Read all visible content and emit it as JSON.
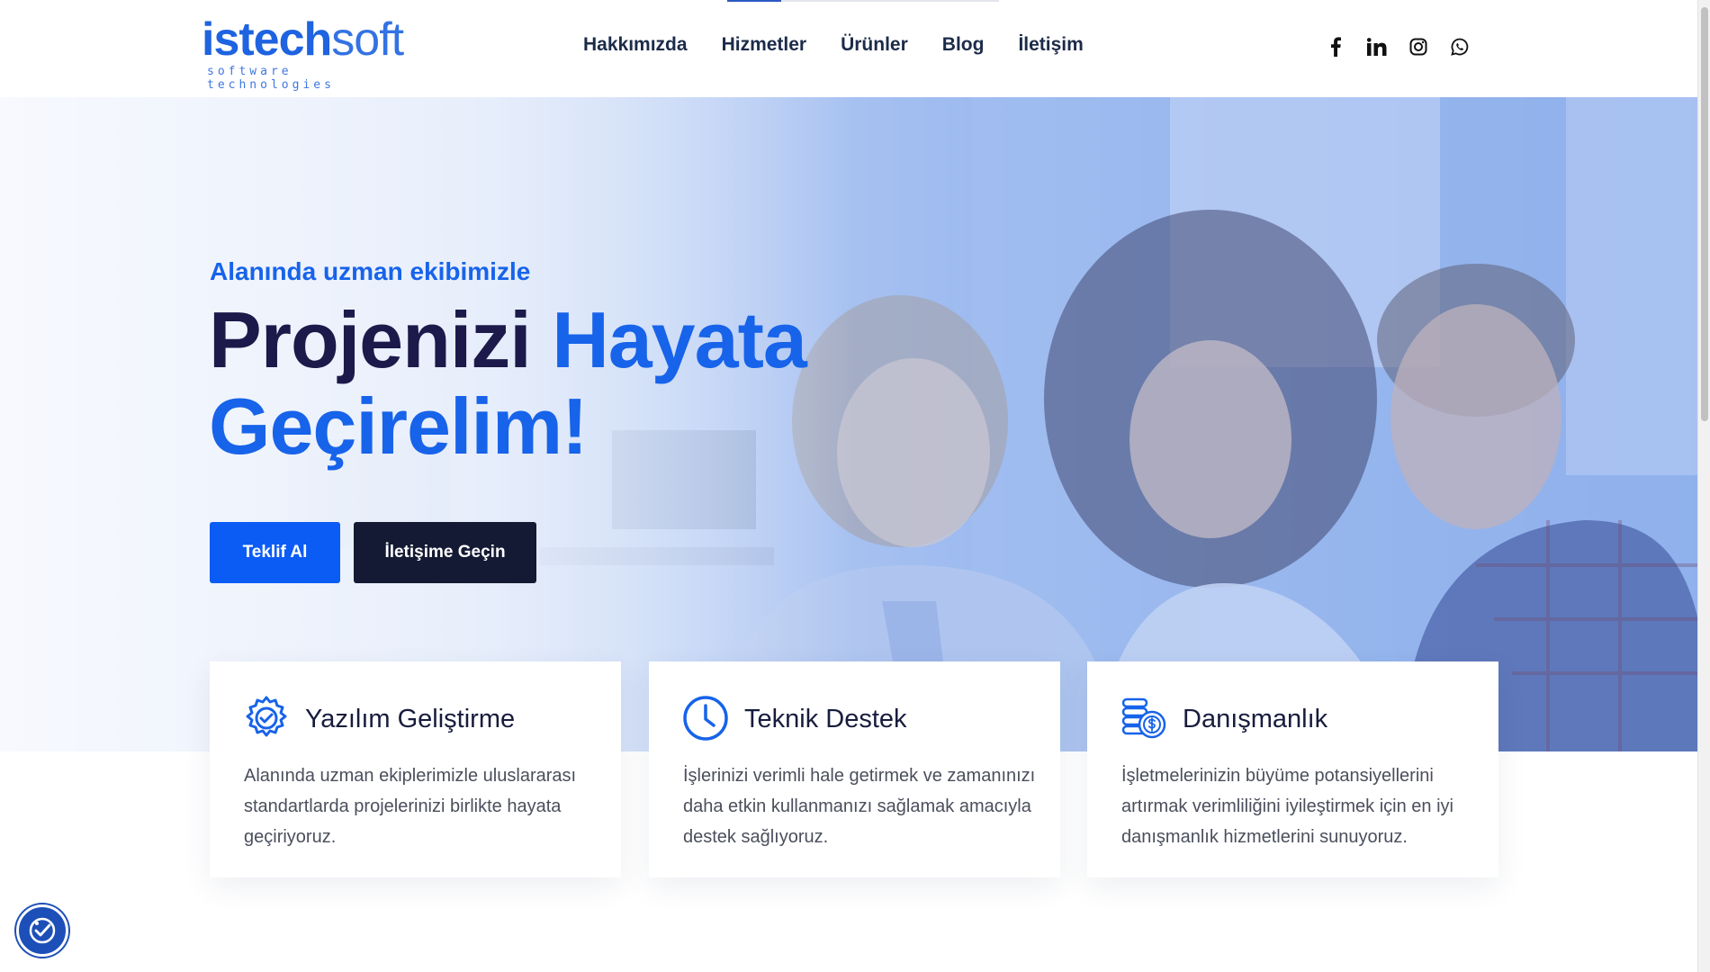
{
  "header": {
    "logo_main_strong": "istech",
    "logo_main_light": "soft",
    "logo_sub": "software technologies",
    "nav": [
      {
        "label": "Hakkımızda"
      },
      {
        "label": "Hizmetler"
      },
      {
        "label": "Ürünler"
      },
      {
        "label": "Blog"
      },
      {
        "label": "İletişim"
      }
    ],
    "social": [
      "facebook-icon",
      "linkedin-icon",
      "instagram-icon",
      "whatsapp-icon"
    ]
  },
  "hero": {
    "eyebrow": "Alanında uzman ekibimizle",
    "headline_dark": "Projenizi ",
    "headline_blue_1": "Hayata",
    "headline_blue_2": "Geçirelim!",
    "primary_button": "Teklif Al",
    "secondary_button": "İletişime Geçin"
  },
  "cards": [
    {
      "icon": "gear-check-icon",
      "title": "Yazılım Geliştirme",
      "description": "Alanında uzman ekiplerimizle uluslararası standartlarda projelerinizi birlikte hayata geçiriyoruz."
    },
    {
      "icon": "clock-icon",
      "title": "Teknik Destek",
      "description": "İşlerinizi verimli hale getirmek ve zamanınızı daha etkin kullanmanızı sağlamak amacıyla destek sağlıyoruz."
    },
    {
      "icon": "coins-icon",
      "title": "Danışmanlık",
      "description": "İşletmelerinizin büyüme potansiyellerini artırmak verimliliğini iyileştirmek için en iyi danışmanlık hizmetlerini sunuyoruz."
    }
  ],
  "colors": {
    "brand_blue": "#1763ea",
    "navy": "#1b1a4a",
    "dark_button": "#141a33"
  }
}
